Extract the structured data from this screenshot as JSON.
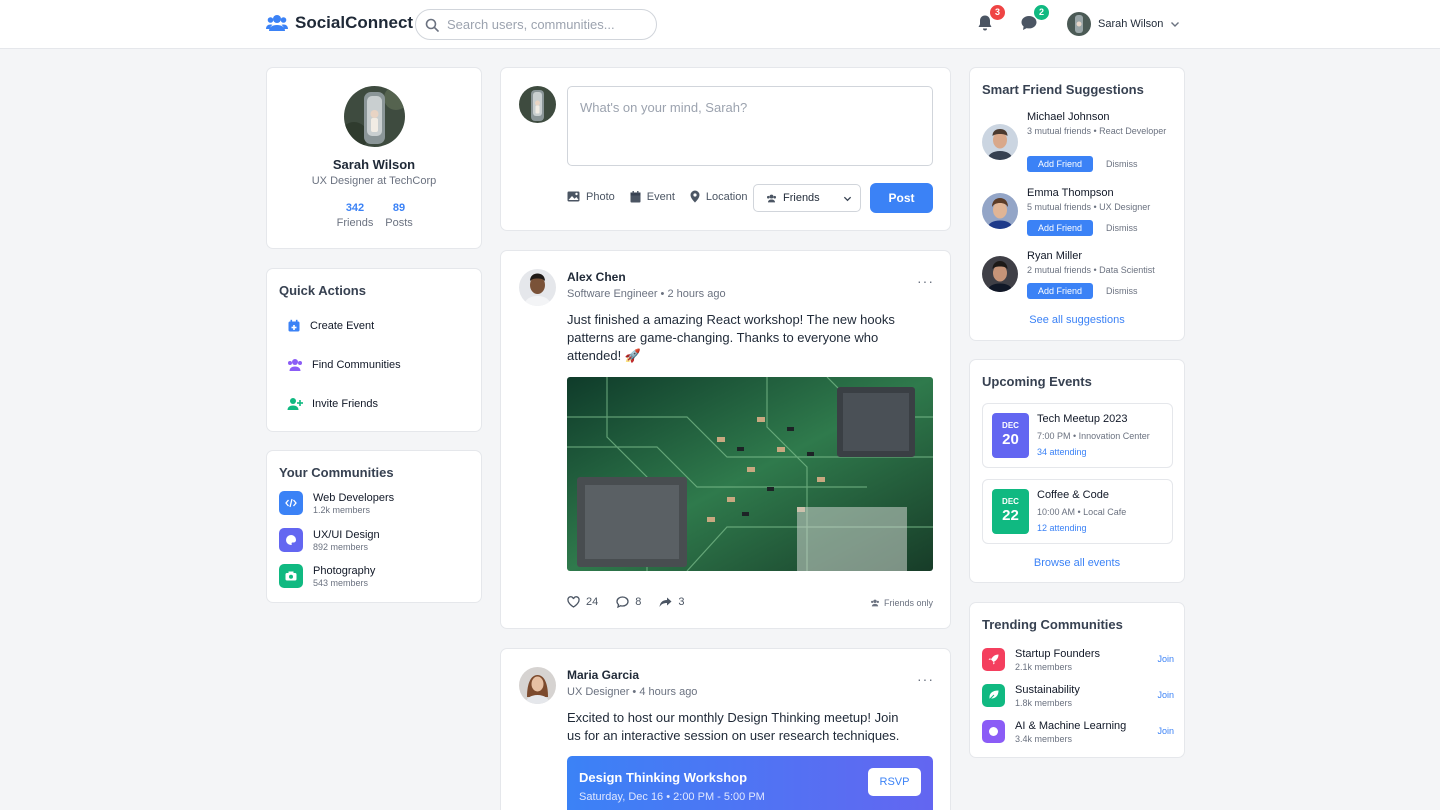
{
  "header": {
    "app_name": "SocialConnect",
    "search_placeholder": "Search users, communities...",
    "notifications_count": "3",
    "messages_count": "2",
    "user_name": "Sarah Wilson"
  },
  "profile": {
    "name": "Sarah Wilson",
    "title": "UX Designer at TechCorp",
    "friends_count": "342",
    "friends_label": "Friends",
    "posts_count": "89",
    "posts_label": "Posts"
  },
  "quick_actions": {
    "title": "Quick Actions",
    "items": [
      {
        "label": "Create Event",
        "icon": "calendar-plus-icon"
      },
      {
        "label": "Find Communities",
        "icon": "users-icon"
      },
      {
        "label": "Invite Friends",
        "icon": "user-plus-icon"
      }
    ]
  },
  "communities": {
    "title": "Your Communities",
    "items": [
      {
        "name": "Web Developers",
        "members": "1.2k members",
        "icon": "code-icon",
        "color": "#3b82f6"
      },
      {
        "name": "UX/UI Design",
        "members": "892 members",
        "icon": "palette-icon",
        "color": "#6366f1"
      },
      {
        "name": "Photography",
        "members": "543 members",
        "icon": "camera-icon",
        "color": "#10b981"
      }
    ]
  },
  "composer": {
    "placeholder": "What's on your mind, Sarah?",
    "photo_label": "Photo",
    "event_label": "Event",
    "location_label": "Location",
    "audience": "Friends",
    "post_label": "Post"
  },
  "posts": [
    {
      "author": "Alex Chen",
      "role": "Software Engineer",
      "time": "2 hours ago",
      "text": "Just finished a amazing React workshop! The new hooks patterns are game-changing. Thanks to everyone who attended! 🚀",
      "likes": "24",
      "comments": "8",
      "shares": "3",
      "visibility": "Friends only"
    },
    {
      "author": "Maria Garcia",
      "role": "UX Designer",
      "time": "4 hours ago",
      "text": "Excited to host our monthly Design Thinking meetup! Join us for an interactive session on user research techniques.",
      "event_title": "Design Thinking Workshop",
      "event_time": "Saturday, Dec 16 • 2:00 PM - 5:00 PM",
      "rsvp_label": "RSVP"
    }
  ],
  "suggestions": {
    "title": "Smart Friend Suggestions",
    "add_label": "Add Friend",
    "dismiss_label": "Dismiss",
    "see_all": "See all suggestions",
    "items": [
      {
        "name": "Michael Johnson",
        "meta": "3 mutual friends • React Developer"
      },
      {
        "name": "Emma Thompson",
        "meta": "5 mutual friends • UX Designer"
      },
      {
        "name": "Ryan Miller",
        "meta": "2 mutual friends • Data Scientist"
      }
    ]
  },
  "events": {
    "title": "Upcoming Events",
    "browse_all": "Browse all events",
    "items": [
      {
        "month": "DEC",
        "day": "20",
        "title": "Tech Meetup 2023",
        "time": "7:00 PM • Innovation Center",
        "attending": "34 attending",
        "color": "#6366f1"
      },
      {
        "month": "DEC",
        "day": "22",
        "title": "Coffee & Code",
        "time": "10:00 AM • Local Cafe",
        "attending": "12 attending",
        "color": "#10b981"
      }
    ]
  },
  "trending": {
    "title": "Trending Communities",
    "join_label": "Join",
    "items": [
      {
        "name": "Startup Founders",
        "members": "2.1k members",
        "icon": "rocket-icon",
        "color": "#f43f5e"
      },
      {
        "name": "Sustainability",
        "members": "1.8k members",
        "icon": "leaf-icon",
        "color": "#10b981"
      },
      {
        "name": "AI & Machine Learning",
        "members": "3.4k members",
        "icon": "brain-icon",
        "color": "#8b5cf6"
      }
    ]
  }
}
